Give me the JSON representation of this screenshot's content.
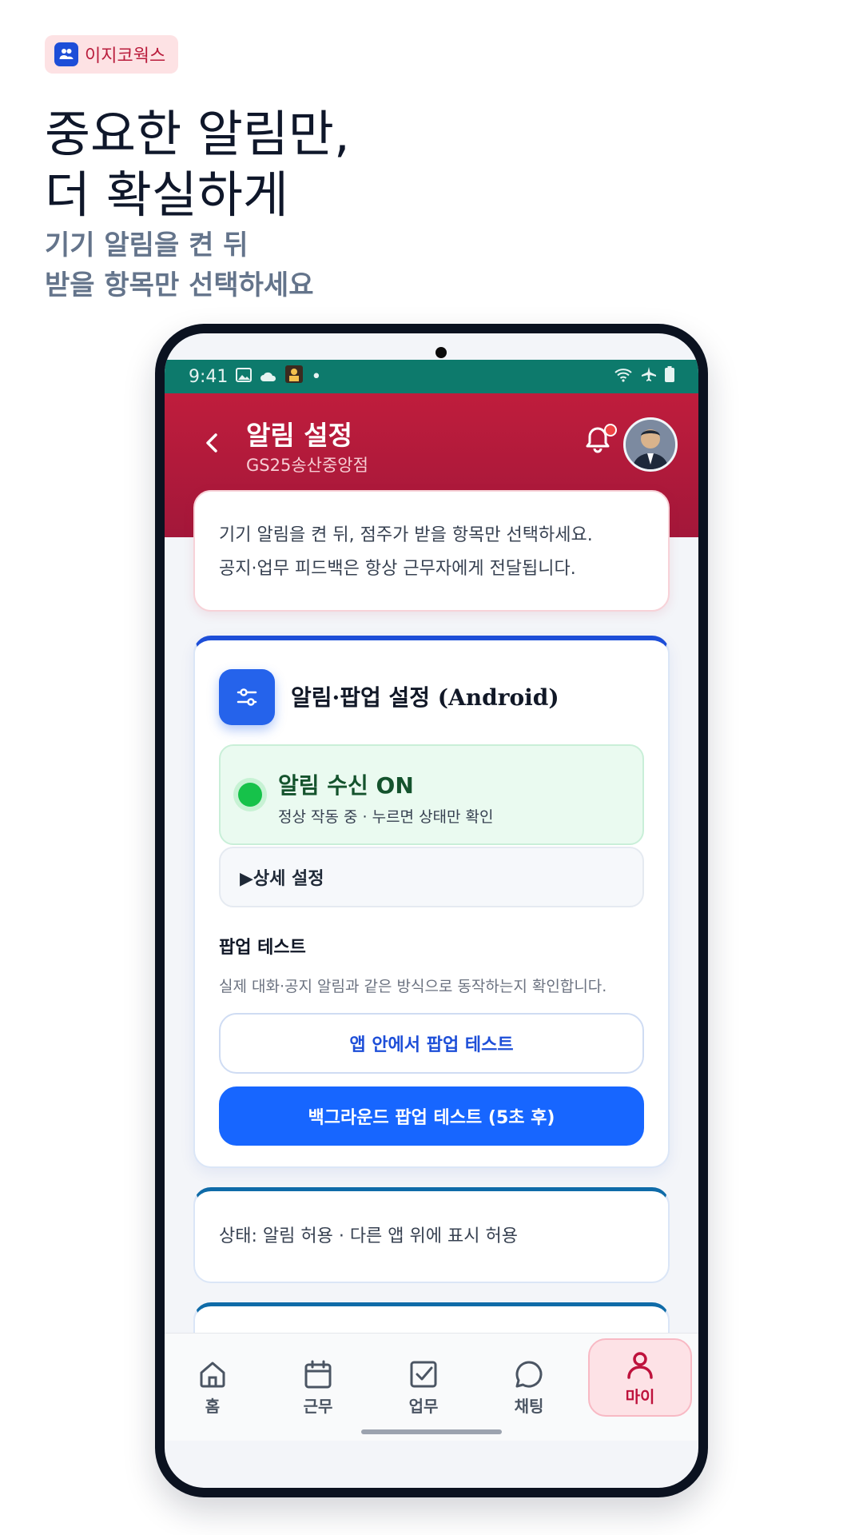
{
  "brand": {
    "name": "이지코웍스"
  },
  "hero": {
    "title_lines": [
      "중요한 알림만,",
      "더 확실하게"
    ],
    "subtitle_lines": [
      "기기 알림을 켠 뒤",
      "받을 항목만 선택하세요"
    ]
  },
  "statusbar": {
    "time": "9:41",
    "dot": "•"
  },
  "appbar": {
    "title": "알림 설정",
    "subtitle": "GS25송산중앙점"
  },
  "info_card": {
    "lines": [
      "기기 알림을 켠 뒤, 점주가 받을 항목만 선택하세요.",
      "공지·업무 피드백은 항상 근무자에게 전달됩니다."
    ]
  },
  "settings_card": {
    "title": "알림·팝업 설정 (Android)",
    "status_title": "알림 수신 ON",
    "status_desc": "정상 작동 중 · 누르면 상태만 확인",
    "detail_toggle": "▶상세 설정",
    "popup_heading": "팝업 테스트",
    "popup_desc": "실제 대화·공지 알림과 같은 방식으로 동작하는지 확인합니다.",
    "in_app_button": "앱 안에서 팝업 테스트",
    "background_button": "백그라운드 팝업 테스트 (5초 후)"
  },
  "state_card": {
    "text": "상태: 알림 허용 · 다른 앱 위에 표시 허용"
  },
  "tabs": [
    {
      "label": "홈",
      "icon": "home-icon"
    },
    {
      "label": "근무",
      "icon": "calendar-icon"
    },
    {
      "label": "업무",
      "icon": "checkbox-icon"
    },
    {
      "label": "채팅",
      "icon": "chat-icon"
    },
    {
      "label": "마이",
      "icon": "user-icon",
      "active": true
    }
  ],
  "colors": {
    "appbar": "#bf1d3c",
    "statusbar": "#0d7a6c",
    "primary": "#1766ff",
    "status_on": "#16c24a",
    "active_tab": "#be123c"
  }
}
